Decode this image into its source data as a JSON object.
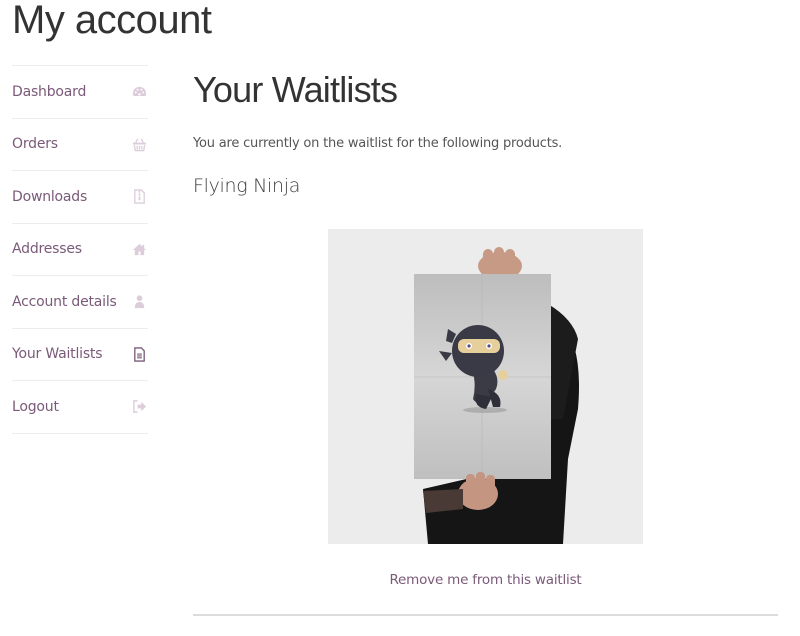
{
  "page": {
    "title": "My account"
  },
  "sidebar": {
    "items": [
      {
        "label": "Dashboard",
        "icon": "dashboard-icon",
        "active": false
      },
      {
        "label": "Orders",
        "icon": "basket-icon",
        "active": false
      },
      {
        "label": "Downloads",
        "icon": "file-archive-icon",
        "active": false
      },
      {
        "label": "Addresses",
        "icon": "home-icon",
        "active": false
      },
      {
        "label": "Account details",
        "icon": "user-icon",
        "active": false
      },
      {
        "label": "Your Waitlists",
        "icon": "file-text-icon",
        "active": true
      },
      {
        "label": "Logout",
        "icon": "sign-out-icon",
        "active": false
      }
    ]
  },
  "main": {
    "heading": "Your Waitlists",
    "intro": "You are currently on the waitlist for the following products.",
    "products": [
      {
        "name": "Flying Ninja",
        "image_alt": "Poster of a flying ninja held by a person",
        "remove_label": "Remove me from this waitlist"
      }
    ]
  },
  "colors": {
    "link": "#7a5a78",
    "icon_inactive": "#ddcddb",
    "text": "#333333",
    "border": "#ececec"
  }
}
